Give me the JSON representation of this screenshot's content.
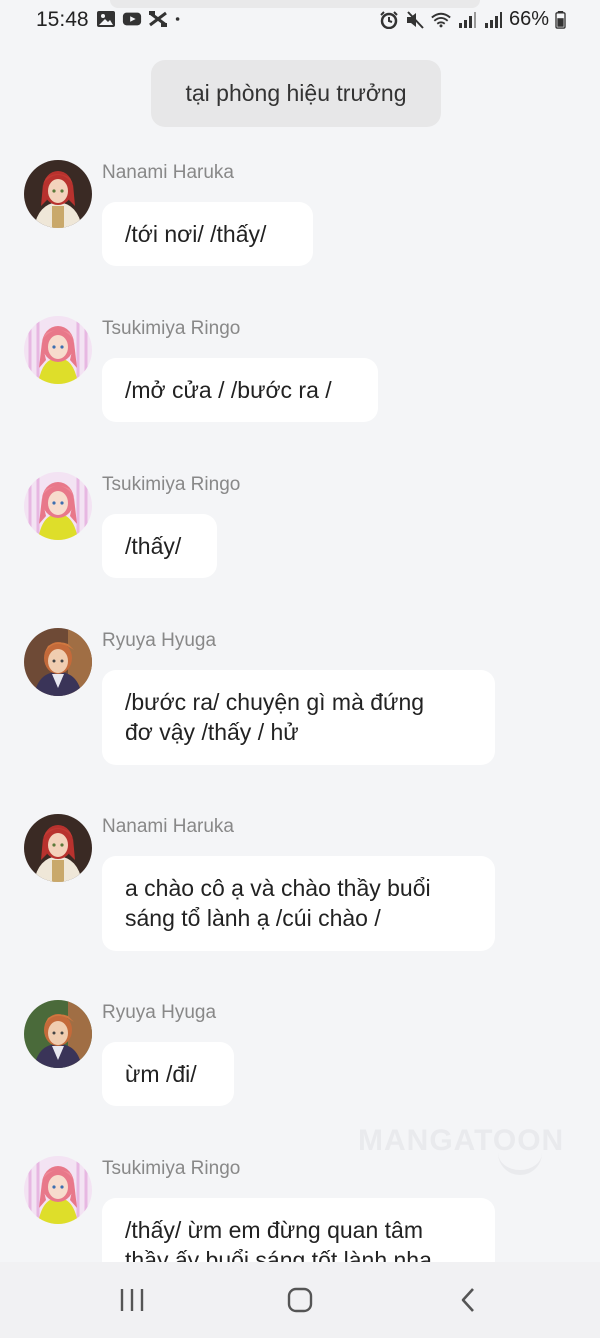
{
  "status_bar": {
    "time": "15:48",
    "battery": "66%",
    "left_icons": [
      "gallery-icon",
      "youtube-icon",
      "capcut-icon",
      "dot-icon"
    ],
    "right_icons": [
      "alarm-icon",
      "mute-icon",
      "wifi-icon",
      "signal-icon",
      "signal-icon",
      "battery-icon"
    ]
  },
  "scene": {
    "label": "tại phòng hiệu trưởng"
  },
  "messages": [
    {
      "sender": "Nanami Haruka",
      "text": "/tới nơi/ /thấy/"
    },
    {
      "sender": "Tsukimiya Ringo",
      "text": "/mở cửa / /bước ra /"
    },
    {
      "sender": "Tsukimiya Ringo",
      "text": "/thấy/"
    },
    {
      "sender": "Ryuya Hyuga",
      "text_lines": [
        "/bước ra/ chuyện gì mà đứng",
        "đơ vậy /thấy / hử"
      ]
    },
    {
      "sender": "Nanami Haruka",
      "text_lines": [
        "a chào cô ạ và chào thầy buổi",
        "sáng tổ lành ạ /cúi chào /"
      ]
    },
    {
      "sender": "Ryuya Hyuga",
      "text": "ừm /đi/"
    },
    {
      "sender": "Tsukimiya Ringo",
      "text_lines": [
        "/thấy/ ừm em đừng quan tâm",
        "thầy ấy buổi sáng tốt lành nha"
      ]
    }
  ],
  "watermark": "MANGATOON",
  "nav": {
    "icons": [
      "recent-apps-icon",
      "home-icon",
      "back-icon"
    ]
  }
}
